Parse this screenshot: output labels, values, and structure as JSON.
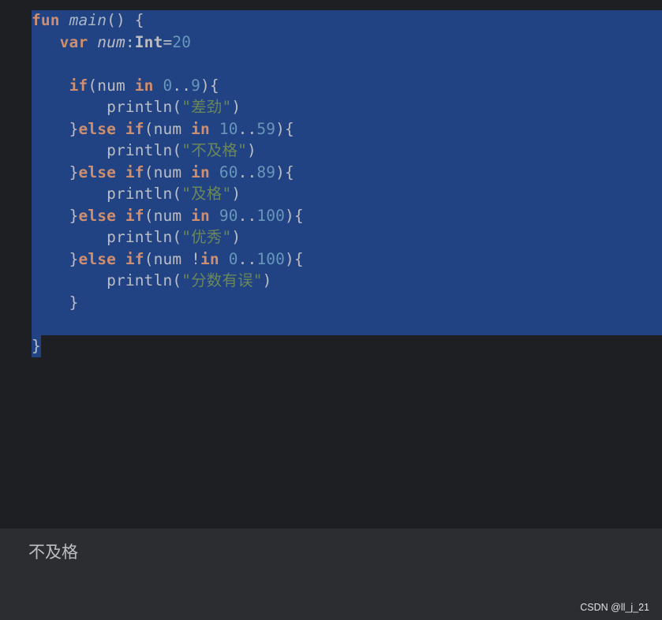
{
  "editor": {
    "code": {
      "l1_kw": "fun",
      "l1_name": "main",
      "l1_rest": "() {",
      "l2_kw": "var",
      "l2_name": "num",
      "l2_colon": ":",
      "l2_type": "Int",
      "l2_eq": "=",
      "l2_val": "20",
      "l4_if": "if",
      "l4_open": "(num ",
      "l4_in": "in",
      "l4_a": "0",
      "l4_dots": "..",
      "l4_b": "9",
      "l4_close": "){",
      "l5_fn": "println(",
      "l5_str": "\"差劲\"",
      "l5_close": ")",
      "l6_brace": "}",
      "l6_else": "else",
      "l6_if": "if",
      "l6_open": "(num ",
      "l6_in": "in",
      "l6_a": "10",
      "l6_dots": "..",
      "l6_b": "59",
      "l6_close": "){",
      "l7_fn": "println(",
      "l7_str": "\"不及格\"",
      "l7_close": ")",
      "l8_brace": "}",
      "l8_else": "else",
      "l8_if": "if",
      "l8_open": "(num ",
      "l8_in": "in",
      "l8_a": "60",
      "l8_dots": "..",
      "l8_b": "89",
      "l8_close": "){",
      "l9_fn": "println(",
      "l9_str": "\"及格\"",
      "l9_close": ")",
      "l10_brace": "}",
      "l10_else": "else",
      "l10_if": "if",
      "l10_open": "(num ",
      "l10_in": "in",
      "l10_a": "90",
      "l10_dots": "..",
      "l10_b": "100",
      "l10_close": "){",
      "l11_fn": "println(",
      "l11_str": "\"优秀\"",
      "l11_close": ")",
      "l12_brace": "}",
      "l12_else": "else",
      "l12_if": "if",
      "l12_open": "(num ",
      "l12_not": "!",
      "l12_in": "in",
      "l12_a": "0",
      "l12_dots": "..",
      "l12_b": "100",
      "l12_close": "){",
      "l13_fn": "println(",
      "l13_str": "\"分数有误\"",
      "l13_close": ")",
      "l14_brace": "}",
      "l16_brace": "}"
    }
  },
  "console": {
    "output": "不及格"
  },
  "watermark": "CSDN @ll_j_21",
  "colors": {
    "background": "#1e1f22",
    "selection": "#214283",
    "keyword": "#cf8e6d",
    "number": "#6897bb",
    "string": "#6a8759",
    "console_bg": "#2b2d30"
  }
}
